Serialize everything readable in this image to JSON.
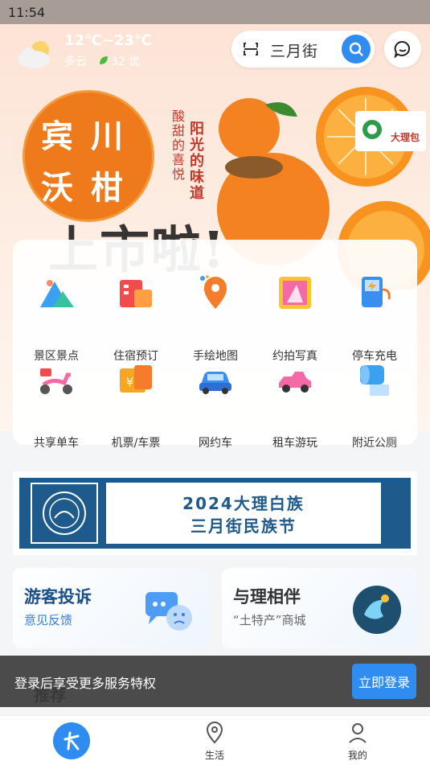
{
  "status_bar": {
    "time": "11:54"
  },
  "weather": {
    "temperature": "12℃~23℃",
    "condition": "多云",
    "aqi": "32 优"
  },
  "search": {
    "query": "三月街"
  },
  "banner": {
    "seal_chars": [
      "宾",
      "川",
      "沃",
      "柑"
    ],
    "poem_right": "阳光的味道",
    "poem_left": "酸甜的喜悦",
    "headline": "上市啦!",
    "logo_text": "大理包"
  },
  "services": [
    {
      "label": "景区景点",
      "icon": "mountain-icon"
    },
    {
      "label": "住宿预订",
      "icon": "hotel-icon"
    },
    {
      "label": "手绘地图",
      "icon": "map-pin-icon"
    },
    {
      "label": "约拍写真",
      "icon": "photo-icon"
    },
    {
      "label": "停车充电",
      "icon": "charging-icon"
    },
    {
      "label": "共享单车",
      "icon": "scooter-icon"
    },
    {
      "label": "机票/车票",
      "icon": "ticket-icon"
    },
    {
      "label": "网约车",
      "icon": "car-icon"
    },
    {
      "label": "租车游玩",
      "icon": "convertible-icon"
    },
    {
      "label": "附近公厕",
      "icon": "toilet-paper-icon"
    }
  ],
  "ad_banner": {
    "line1": "2024大理白族",
    "line2": "三月街民族节"
  },
  "cards": {
    "complaint": {
      "title": "游客投诉",
      "subtitle": "意见反馈"
    },
    "shop": {
      "title": "与理相伴",
      "subtitle": "“土特产”商城"
    }
  },
  "section": {
    "title": "推荐"
  },
  "login_bar": {
    "text": "登录后享受更多服务特权",
    "button": "立即登录"
  },
  "tabs": [
    {
      "label": ""
    },
    {
      "label": "生活"
    },
    {
      "label": "我的"
    }
  ],
  "colors": {
    "accent": "#2f8cf0",
    "orange": "#ee7a1c",
    "ad_blue": "#1f5a8c"
  }
}
